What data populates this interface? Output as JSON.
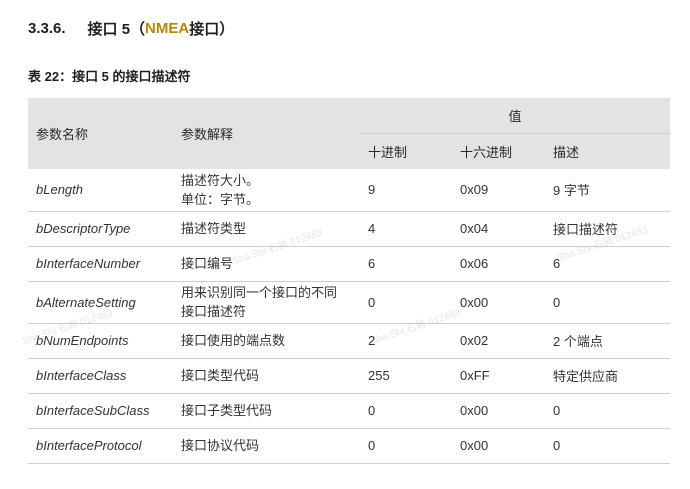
{
  "heading": {
    "number": "3.3.6.",
    "prefix": "接口 5（",
    "nmea": "NMEA",
    "suffix": " 接口）"
  },
  "caption": "表 22：接口 5 的接口描述符",
  "table": {
    "headers": {
      "param_name": "参数名称",
      "param_desc": "参数解释",
      "value_group": "值",
      "decimal": "十进制",
      "hex": "十六进制",
      "description": "描述"
    },
    "rows": [
      {
        "name": "bLength",
        "desc_lines": [
          "描述符大小。",
          "单位：字节。"
        ],
        "dec": "9",
        "hex": "0x09",
        "description": "9 字节"
      },
      {
        "name": "bDescriptorType",
        "desc_lines": [
          "描述符类型"
        ],
        "dec": "4",
        "hex": "0x04",
        "description": "接口描述符"
      },
      {
        "name": "bInterfaceNumber",
        "desc_lines": [
          "接口编号"
        ],
        "dec": "6",
        "hex": "0x06",
        "description": "6"
      },
      {
        "name": "bAlternateSetting",
        "desc_lines": [
          "用来识别同一个接口的不同",
          "接口描述符"
        ],
        "dec": "0",
        "hex": "0x00",
        "description": "0"
      },
      {
        "name": "bNumEndpoints",
        "desc_lines": [
          "接口使用的端点数"
        ],
        "dec": "2",
        "hex": "0x02",
        "description": "2 个端点"
      },
      {
        "name": "bInterfaceClass",
        "desc_lines": [
          "接口类型代码"
        ],
        "dec": "255",
        "hex": "0xFF",
        "description": "特定供应商"
      },
      {
        "name": "bInterfaceSubClass",
        "desc_lines": [
          "接口子类型代码"
        ],
        "dec": "0",
        "hex": "0x00",
        "description": "0"
      },
      {
        "name": "bInterfaceProtocol",
        "desc_lines": [
          "接口协议代码"
        ],
        "dec": "0",
        "hex": "0x00",
        "description": "0"
      }
    ]
  },
  "watermarks": [
    "Sha Shi 石狮 012483",
    "Sha Shi 石狮 012483",
    "Sha Shi 石狮 012483",
    "Sha Shi 石狮 012483"
  ]
}
